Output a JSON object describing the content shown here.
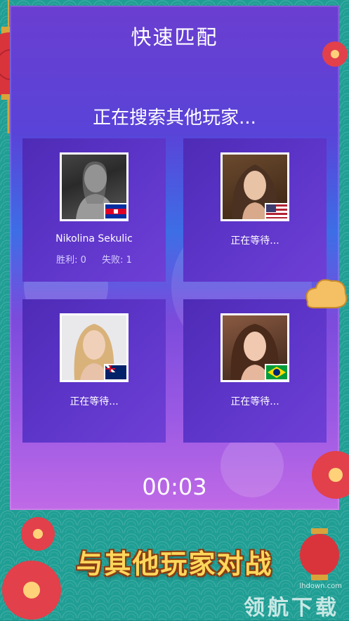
{
  "header": {
    "title": "快速匹配"
  },
  "status": {
    "searching_text": "正在搜索其他玩家..."
  },
  "players": [
    {
      "name": "Nikolina Sekulic",
      "wins_label": "胜利: 0",
      "losses_label": "失败: 1",
      "flag": "cambodia-flag"
    },
    {
      "name": "正在等待...",
      "flag": "usa-flag"
    },
    {
      "name": "正在等待...",
      "flag": "australia-flag"
    },
    {
      "name": "正在等待...",
      "flag": "brazil-flag"
    }
  ],
  "timer": {
    "value": "00:03"
  },
  "banner": {
    "text": "与其他玩家对战"
  },
  "watermark": {
    "url": "lhdown.com",
    "text": "领航下载"
  },
  "colors": {
    "panel_top": "#6a3ed0",
    "panel_bottom": "#c06ae6",
    "card": "#5a33c4",
    "teal": "#1f9e94",
    "banner_gold": "#fcd75b"
  }
}
